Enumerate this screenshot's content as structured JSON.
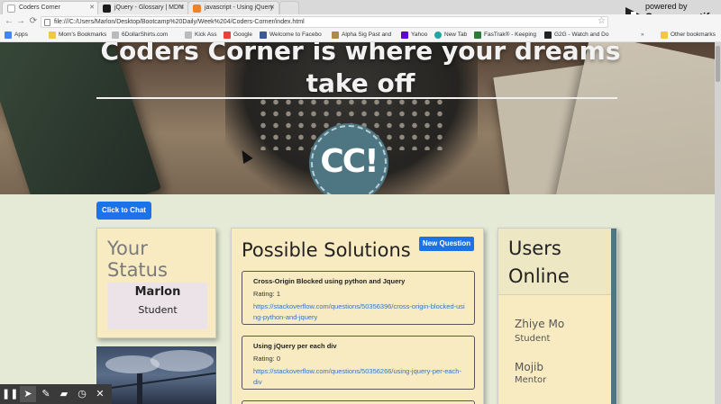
{
  "browser": {
    "tabs": [
      {
        "title": "Coders Corner",
        "color": "#ffffff"
      },
      {
        "title": "jQuery - Glossary | MDN",
        "color": "#1b1b1b"
      },
      {
        "title": "javascript - Using jQuery",
        "color": "#f48024"
      }
    ],
    "url": "file:///C:/Users/Marlon/Desktop/Bootcamp%20Daily/Week%204/Coders-Corner/index.html",
    "bookmarks": [
      {
        "label": "Apps",
        "color": "#4285f4"
      },
      {
        "label": "Mom's Bookmarks",
        "color": "#f2c744"
      },
      {
        "label": "6DollarShirts.com",
        "color": "#888888"
      },
      {
        "label": "Kick Ass",
        "color": "#888888"
      },
      {
        "label": "Google",
        "color": "#ea4335"
      },
      {
        "label": "Welcome to Facebo",
        "color": "#3b5998"
      },
      {
        "label": "Alpha Sig Past and",
        "color": "#b08a46"
      },
      {
        "label": "Yahoo",
        "color": "#5f01d1"
      },
      {
        "label": "New Tab",
        "color": "#1ea7a0"
      },
      {
        "label": "FasTrak® - Keeping",
        "color": "#2a7a3a"
      },
      {
        "label": "G2G - Watch and Do",
        "color": "#222222"
      }
    ],
    "other_bookmarks": "Other bookmarks"
  },
  "screencastify": {
    "powered": "powered by",
    "name": "Screencastify"
  },
  "hero": {
    "title_line1": "Coders Corner is where your dreams",
    "title_line2": "take off",
    "logo_text": "CC!"
  },
  "chat_button": "Click to Chat",
  "status": {
    "title_line1": "Your",
    "title_line2": "Status",
    "name": "Marlon",
    "role": "Student"
  },
  "solutions": {
    "title": "Possible Solutions",
    "new_question": "New Question",
    "items": [
      {
        "question": "Cross-Origin Blocked using python and Jquery",
        "rating": "Rating: 1",
        "url": "https://stackoverflow.com/questions/50356396/cross-origin-blocked-using-python-and-jquery"
      },
      {
        "question": "Using jQuery per each div",
        "rating": "Rating: 0",
        "url": "https://stackoverflow.com/questions/50356266/using-jquery-per-each-div"
      }
    ]
  },
  "users_online": {
    "title_line1": "Users",
    "title_line2": "Online",
    "users": [
      {
        "name": "Zhiye Mo",
        "role": "Student"
      },
      {
        "name": "Mojib",
        "role": "Mentor"
      }
    ]
  },
  "colors": {
    "accent_blue": "#1a73e8",
    "card_bg": "#f8ebc1",
    "page_bg": "#e4ead6",
    "logo_teal": "#4d7582"
  }
}
